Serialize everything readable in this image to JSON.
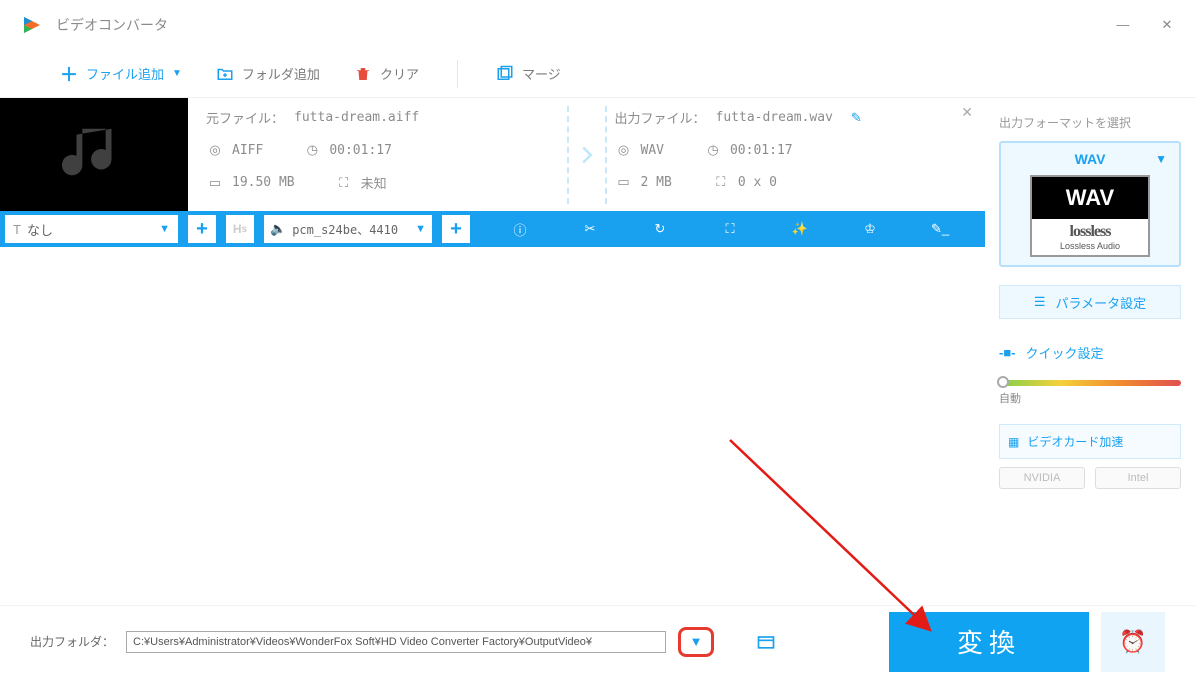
{
  "window": {
    "title": "ビデオコンバータ"
  },
  "toolbar": {
    "add_file": "ファイル追加",
    "add_folder": "フォルダ追加",
    "clear": "クリア",
    "merge": "マージ"
  },
  "file": {
    "source": {
      "label": "元ファイル：",
      "name": "futta-dream.aiff",
      "format": "AIFF",
      "duration": "00:01:17",
      "size": "19.50 MB",
      "resolution": "未知"
    },
    "output": {
      "label": "出力ファイル：",
      "name": "futta-dream.wav",
      "format": "WAV",
      "duration": "00:01:17",
      "size": "2 MB",
      "resolution": "0 x 0"
    }
  },
  "options": {
    "subtitle": "なし",
    "audio_codec": "pcm_s24be、4410"
  },
  "sidebar": {
    "title": "出力フォーマットを選択",
    "format_label": "WAV",
    "format_big": "WAV",
    "lossless": "lossless",
    "lossless_sub": "Lossless Audio",
    "param_btn": "パラメータ設定",
    "quick_label": "クイック設定",
    "auto": "自動",
    "gpu": "ビデオカード加速",
    "nvidia": "NVIDIA",
    "intel": "Intel"
  },
  "bottom": {
    "label": "出力フォルダ：",
    "path": "C:¥Users¥Administrator¥Videos¥WonderFox Soft¥HD Video Converter Factory¥OutputVideo¥",
    "convert": "変換"
  }
}
